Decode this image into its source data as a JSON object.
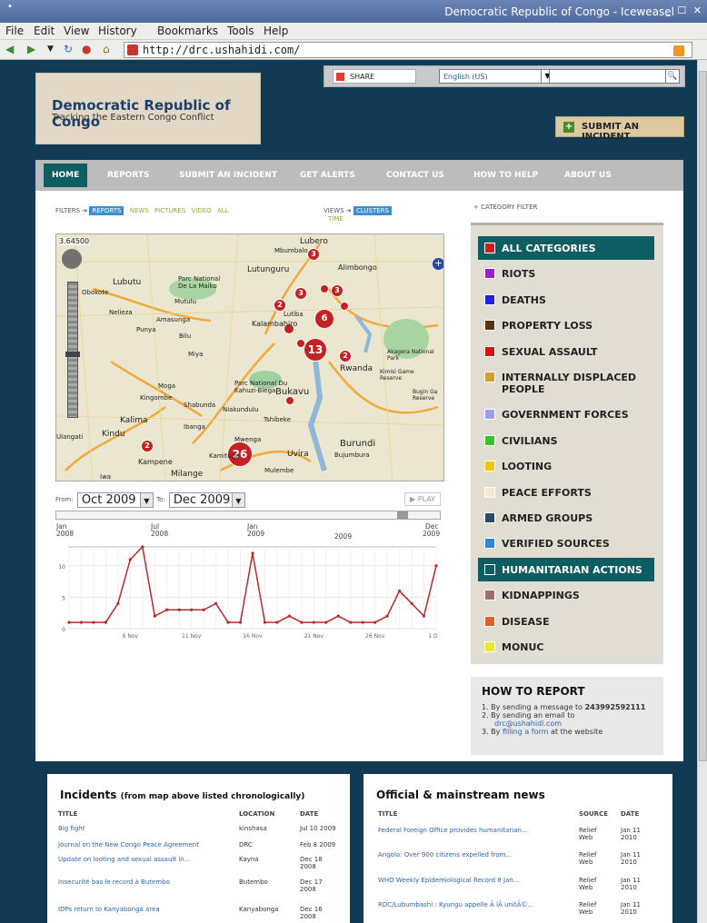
{
  "window": {
    "title": "Democratic Republic of Congo - Iceweasel"
  },
  "menu": [
    "File",
    "Edit",
    "View",
    "History",
    "Bookmarks",
    "Tools",
    "Help"
  ],
  "address": {
    "url": "http://drc.ushahidi.com/"
  },
  "site": {
    "title": "Democratic Republic of Congo",
    "tagline": "Tracking the Eastern Congo Conflict"
  },
  "toolbar": {
    "share": "SHARE",
    "language": "English (US)",
    "search_value": ""
  },
  "submit_button": "SUBMIT AN INCIDENT",
  "nav": [
    "HOME",
    "REPORTS",
    "SUBMIT AN INCIDENT",
    "GET ALERTS",
    "CONTACT US",
    "HOW TO HELP",
    "ABOUT US"
  ],
  "filters": {
    "label": "FILTERS",
    "items": [
      "REPORTS",
      "NEWS",
      "PICTURES",
      "VIDEO",
      "ALL"
    ],
    "views_label": "VIEWS",
    "views": [
      "CLUSTERS",
      "TIME"
    ],
    "category_filter": "CATEGORY FILTER"
  },
  "map": {
    "coord_readout": "3.64500",
    "clusters": [
      "3",
      "3",
      "3",
      "2",
      "6",
      "13",
      "2",
      "2",
      "26"
    ],
    "places": [
      "Lubero",
      "Mbumbalo",
      "Lutunguru",
      "Alimbongo",
      "Lubutu",
      "Parc National De La Maiko",
      "Obokote",
      "Mutulu",
      "Nelieza",
      "Amasunga",
      "Kalambahiro",
      "Lutiba",
      "Punya",
      "Bilu",
      "Miya",
      "Rwanda",
      "Parc National Du Kahuzi-Biega",
      "Bukavu",
      "Moga",
      "Kingombe",
      "Shabunda",
      "Niakundulu",
      "Tshibeke",
      "Kalima",
      "Kindu",
      "Ulangati",
      "Ibanga",
      "Mwenga",
      "Kampene",
      "Kamituga",
      "Milange",
      "Uvira",
      "Burundi",
      "Bujumbura",
      "Mulembe",
      "Iwa",
      "Akagera National Park",
      "Kimisi Game Reserve",
      "Bugin Ga Reserve"
    ]
  },
  "date_range": {
    "from_label": "From:",
    "from": "Oct 2009",
    "to_label": "To:",
    "to": "Dec 2009",
    "play": "PLAY"
  },
  "timeline_ticks": [
    "Jan",
    "2008",
    "Jul",
    "2008",
    "Jan",
    "2009",
    "2009",
    "Dec",
    "2009"
  ],
  "chart_data": {
    "type": "line",
    "x": [
      "1 Nov",
      "2 Nov",
      "3 Nov",
      "4 Nov",
      "5 Nov",
      "6 Nov",
      "7 Nov",
      "8 Nov",
      "9 Nov",
      "10 Nov",
      "11 Nov",
      "12 Nov",
      "13 Nov",
      "14 Nov",
      "15 Nov",
      "16 Nov",
      "17 Nov",
      "18 Nov",
      "19 Nov",
      "20 Nov",
      "21 Nov",
      "22 Nov",
      "23 Nov",
      "24 Nov",
      "25 Nov",
      "26 Nov",
      "27 Nov",
      "28 Nov",
      "29 Nov",
      "30 Nov",
      "1 Dec"
    ],
    "x_tick_labels": [
      "6 Nov",
      "11 Nov",
      "16 Nov",
      "21 Nov",
      "26 Nov",
      "1 Dec"
    ],
    "series": [
      {
        "values": [
          1,
          1,
          1,
          1,
          4,
          11,
          13,
          2,
          3,
          3,
          3,
          3,
          4,
          1,
          1,
          12,
          1,
          1,
          2,
          1,
          1,
          1,
          2,
          1,
          1,
          1,
          2,
          6,
          4,
          2,
          10
        ]
      }
    ],
    "ylim": [
      0,
      13
    ],
    "y_ticks": [
      0,
      5,
      10
    ],
    "grid": true,
    "color": "#b52b2b"
  },
  "categories": [
    {
      "label": "ALL CATEGORIES",
      "color": "#cc1f1f",
      "active": true
    },
    {
      "label": "RIOTS",
      "color": "#9b20c8",
      "active": false
    },
    {
      "label": "DEATHS",
      "color": "#2020e0",
      "active": false
    },
    {
      "label": "PROPERTY LOSS",
      "color": "#5a3410",
      "active": false
    },
    {
      "label": "SEXUAL ASSAULT",
      "color": "#e01010",
      "active": false
    },
    {
      "label": "INTERNALLY DISPLACED PEOPLE",
      "color": "#d4a02a",
      "active": false
    },
    {
      "label": "GOVERNMENT FORCES",
      "color": "#9aa0ec",
      "active": false
    },
    {
      "label": "CIVILIANS",
      "color": "#33c430",
      "active": false
    },
    {
      "label": "LOOTING",
      "color": "#f5c400",
      "active": false
    },
    {
      "label": "PEACE EFFORTS",
      "color": "#f6e8d0",
      "active": false
    },
    {
      "label": "ARMED GROUPS",
      "color": "#2a4a68",
      "active": false
    },
    {
      "label": "VERIFIED SOURCES",
      "color": "#2d86d8",
      "active": false
    },
    {
      "label": "HUMANITARIAN ACTIONS",
      "color": "#0e5d62",
      "active": true
    },
    {
      "label": "KIDNAPPINGS",
      "color": "#a06e6e",
      "active": false
    },
    {
      "label": "DISEASE",
      "color": "#e0622a",
      "active": false
    },
    {
      "label": "MONUC",
      "color": "#e8e830",
      "active": false
    }
  ],
  "how_to_report": {
    "title": "HOW TO REPORT",
    "step1_prefix": "1.  By sending a message to ",
    "step1_number": "243992592111",
    "step2": "2.  By sending an email to",
    "step2_email": "drc@ushahidi.com",
    "step3_prefix": "3.  By ",
    "step3_link": "filling a form",
    "step3_suffix": " at the website"
  },
  "incidents": {
    "title": "Incidents",
    "subtitle": "(from map above listed chronologically)",
    "headers": [
      "TITLE",
      "LOCATION",
      "DATE"
    ],
    "rows": [
      {
        "title": "Big fight",
        "location": "kinshasa",
        "date": "Jul 10 2009"
      },
      {
        "title": "Journal on the New Congo Peace Agreement",
        "location": "DRC",
        "date": "Feb 8 2009"
      },
      {
        "title": "Update on looting and sexual assault in...",
        "location": "Kayna",
        "date": "Dec 18 2008"
      },
      {
        "title": "Insecurité bas le record à Butembo",
        "location": "Butembo",
        "date": "Dec 17 2008"
      },
      {
        "title": "IDPs return to Kanyabonga area",
        "location": "Kanyabonga",
        "date": "Dec 16 2008"
      }
    ]
  },
  "news": {
    "title": "Official & mainstream news",
    "headers": [
      "TITLE",
      "SOURCE",
      "DATE"
    ],
    "rows": [
      {
        "title": "Federal Foreign Office provides humanitarian...",
        "source": "Relief Web",
        "date": "Jan 11 2010"
      },
      {
        "title": "Angola: Over 900 citizens expelled from...",
        "source": "Relief Web",
        "date": "Jan 11 2010"
      },
      {
        "title": "WHO Weekly Epidemiological Record 8 Jan...",
        "source": "Relief Web",
        "date": "Jan 11 2010"
      },
      {
        "title": "RDC/Lubumbashi : Kyungu appelle Ã  lÃ unitÃ©...",
        "source": "Relief Web",
        "date": "Jan 11 2010"
      }
    ]
  }
}
